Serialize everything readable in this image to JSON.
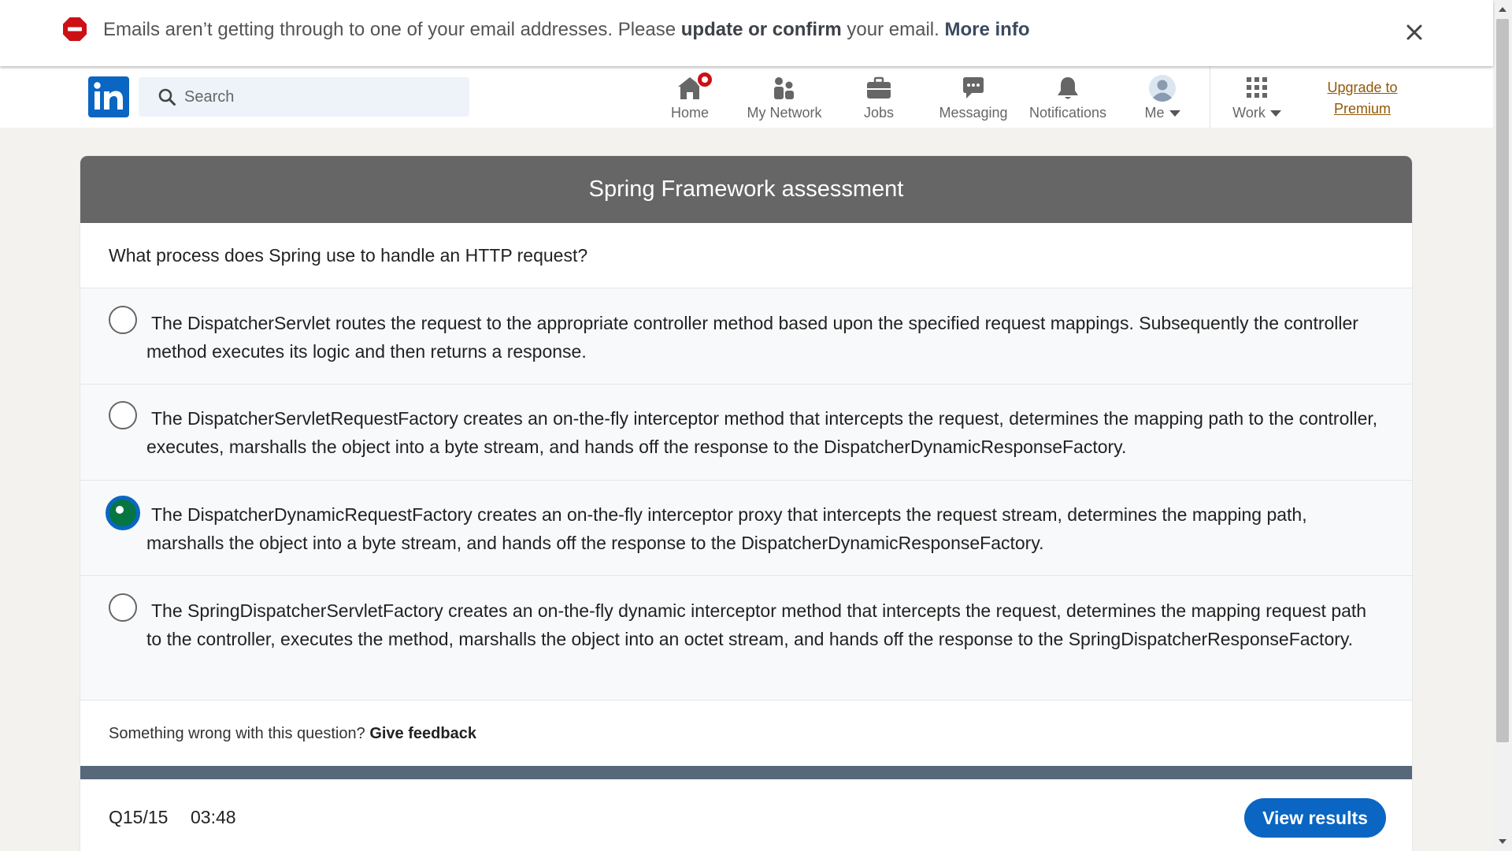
{
  "alert": {
    "message": "Emails aren’t getting through to one of your email addresses. Please ",
    "action_link": "update or confirm",
    "message_tail": " your email. ",
    "more_link": "More info"
  },
  "nav": {
    "logo_text": "in",
    "search_placeholder": "Search",
    "items": [
      {
        "label": "Home",
        "icon": "home-icon"
      },
      {
        "label": "My Network",
        "icon": "network-icon"
      },
      {
        "label": "Jobs",
        "icon": "briefcase-icon"
      },
      {
        "label": "Messaging",
        "icon": "messaging-icon"
      },
      {
        "label": "Notifications",
        "icon": "bell-icon"
      },
      {
        "label": "Me",
        "icon": "avatar-icon"
      },
      {
        "label": "Work",
        "icon": "grid-icon"
      }
    ],
    "upgrade_line1": "Upgrade to",
    "upgrade_line2": "Premium"
  },
  "assessment": {
    "title": "Spring Framework assessment",
    "question": "What process does Spring use to handle an HTTP request?",
    "options": [
      {
        "text": "The DispatcherServlet routes the request to the appropriate controller method based upon the specified request mappings. Subsequently the controller method executes its logic and then returns a response.",
        "selected": false
      },
      {
        "text": "The DispatcherServletRequestFactory creates an on-the-fly interceptor method that intercepts the request, determines the mapping path to the controller, executes, marshalls the object into a byte stream, and hands off the response to the DispatcherDynamicResponseFactory.",
        "selected": false
      },
      {
        "text": "The DispatcherDynamicRequestFactory creates an on-the-fly interceptor proxy that intercepts the request stream, determines the mapping path, marshalls the object into a byte stream, and hands off the response to the DispatcherDynamicResponseFactory.",
        "selected": true
      },
      {
        "text": "The SpringDispatcherServletFactory creates an on-the-fly dynamic interceptor method that intercepts the request, determines the mapping request path to the controller, executes the method, marshalls the object into an octet stream, and hands off the response to the SpringDispatcherResponseFactory.",
        "selected": false
      }
    ],
    "feedback_prompt": "Something wrong with this question? ",
    "feedback_link": "Give feedback",
    "progress_fraction": 1.0,
    "counter": "Q15/15",
    "timer": "03:48",
    "view_results_label": "View results"
  },
  "colors": {
    "brand": "#0a66c2",
    "selected_radio": "#057642",
    "header_bg": "#666666",
    "alert_icon": "#cc1016"
  }
}
